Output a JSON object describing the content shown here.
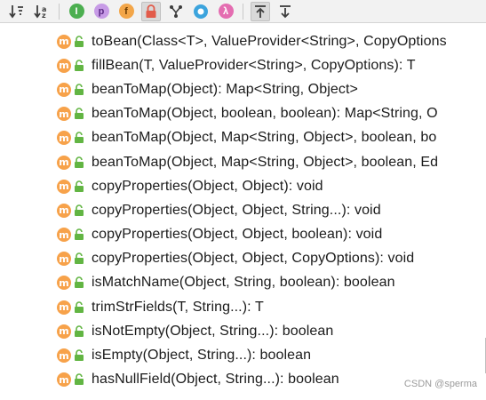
{
  "toolbar": {
    "buttons": [
      {
        "name": "sort-by-visibility-icon"
      },
      {
        "name": "sort-alphabetically-icon",
        "glyph": "↓a"
      },
      {
        "name": "show-interfaces-icon",
        "glyph": "I",
        "color": "#4caf50"
      },
      {
        "name": "show-properties-icon",
        "glyph": "p",
        "color": "#b37ad6"
      },
      {
        "name": "show-fields-icon",
        "glyph": "f",
        "color": "#f3a649"
      },
      {
        "name": "show-non-public-icon",
        "color": "#e25b4a"
      },
      {
        "name": "show-inherited-icon"
      },
      {
        "name": "show-anonymous-icon",
        "color": "#3ca4dd"
      },
      {
        "name": "show-lambdas-icon",
        "glyph": "λ",
        "color": "#e46db1"
      },
      {
        "name": "autoscroll-to-source-icon"
      },
      {
        "name": "autoscroll-from-source-icon"
      }
    ]
  },
  "method_badge": "m",
  "methods": [
    "toBean(Class<T>, ValueProvider<String>, CopyOptions",
    "fillBean(T, ValueProvider<String>, CopyOptions): T",
    "beanToMap(Object): Map<String, Object>",
    "beanToMap(Object, boolean, boolean): Map<String, O",
    "beanToMap(Object, Map<String, Object>, boolean, bo",
    "beanToMap(Object, Map<String, Object>, boolean, Ed",
    "copyProperties(Object, Object): void",
    "copyProperties(Object, Object, String...): void",
    "copyProperties(Object, Object, boolean): void",
    "copyProperties(Object, Object, CopyOptions): void",
    "isMatchName(Object, String, boolean): boolean",
    "trimStrFields(T, String...): T",
    "isNotEmpty(Object, String...): boolean",
    "isEmpty(Object, String...): boolean",
    "hasNullField(Object, String...): boolean"
  ],
  "watermark": "CSDN @sperma",
  "colors": {
    "method_badge": "#f7a24a",
    "public_lock": "#62b543",
    "toolbar_bg": "#f2f2f2"
  }
}
